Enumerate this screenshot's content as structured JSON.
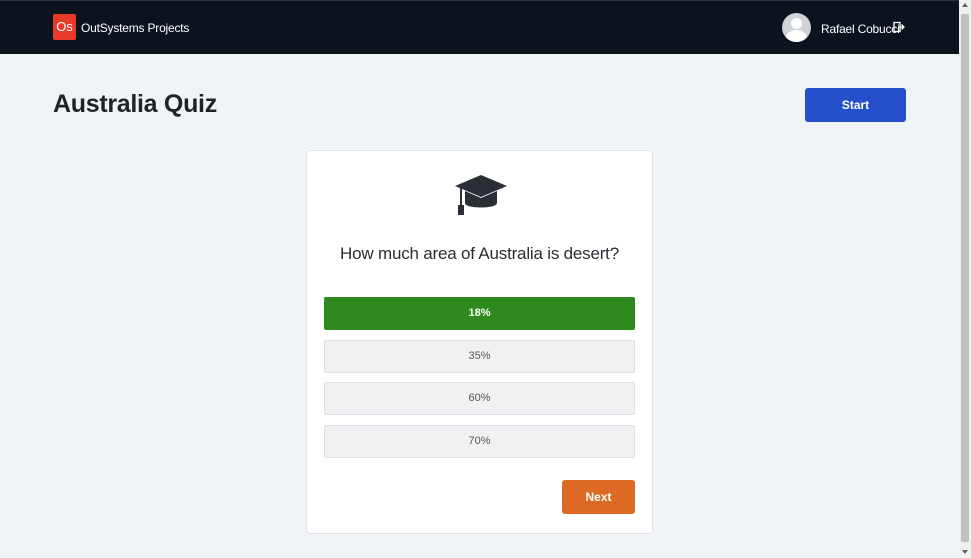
{
  "header": {
    "logo_text": "Os",
    "app_name": "OutSystems Projects",
    "user_name": "Rafael Cobucci",
    "icons": {
      "avatar": "user-avatar-icon",
      "logout": "logout-icon"
    }
  },
  "page": {
    "title": "Australia Quiz",
    "start_label": "Start"
  },
  "quiz": {
    "icon": "graduation-cap-icon",
    "question": "How much area of Australia is desert?",
    "answers": [
      {
        "label": "18%",
        "state": "correct"
      },
      {
        "label": "35%",
        "state": "default"
      },
      {
        "label": "60%",
        "state": "default"
      },
      {
        "label": "70%",
        "state": "default"
      }
    ],
    "next_label": "Next"
  },
  "colors": {
    "header_bg": "#0b131c",
    "brand_red": "#e8392b",
    "primary_blue": "#2550cc",
    "correct_green": "#2f8a1d",
    "next_orange": "#dd6a22"
  }
}
